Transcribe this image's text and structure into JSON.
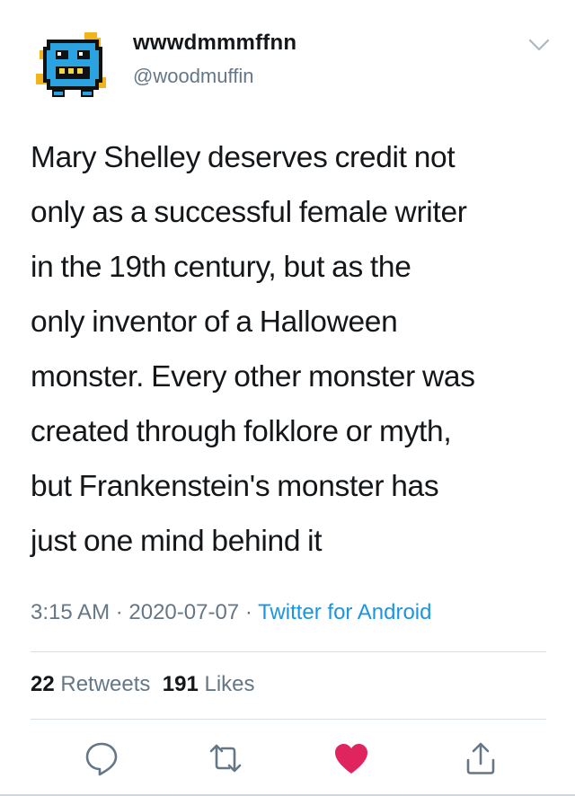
{
  "user": {
    "display_name": "wwwdmmmffnn",
    "handle": "@woodmuffin",
    "avatar_icon": "blue-pixel-monster-avatar"
  },
  "tweet": {
    "text": "Mary Shelley deserves credit not\nonly as a successful female writer\nin the 19th century, but as the\nonly inventor of a Halloween\nmonster. Every other monster was\ncreated through folklore or myth,\nbut Frankenstein's monster has\njust one mind behind it"
  },
  "meta": {
    "time": "3:15 AM",
    "separator1": " · ",
    "date": "2020-07-07",
    "separator2": " · ",
    "source": "Twitter for Android"
  },
  "stats": {
    "retweets_count": "22",
    "retweets_label": "Retweets",
    "likes_count": "191",
    "likes_label": "Likes"
  },
  "actions": {
    "reply_icon": "reply-icon",
    "retweet_icon": "retweet-icon",
    "like_icon": "heart-icon",
    "share_icon": "share-icon"
  },
  "colors": {
    "link_blue": "#1b95e0",
    "secondary_gray": "#657786",
    "like_red": "#e0245e",
    "text_dark": "#14171a"
  }
}
